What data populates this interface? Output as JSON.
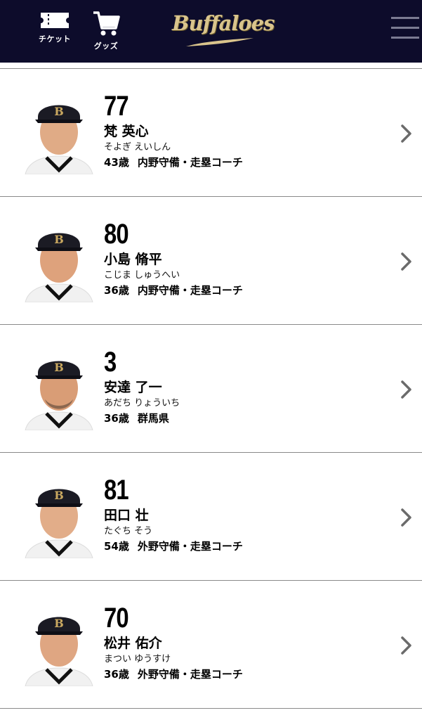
{
  "header": {
    "ticket_label": "チケット",
    "goods_label": "グッズ",
    "logo_text": "Buffaloes",
    "logo_icon": "buffaloes-logo",
    "menu_icon": "hamburger-menu-icon",
    "colors": {
      "header_bg": "#0d0c2b",
      "logo_gold": "#d9c48c",
      "menu_lines": "#7b7b92"
    }
  },
  "staff": [
    {
      "number": "77",
      "name": "梵 英心",
      "kana": "そよぎ えいしん",
      "age": "43歳",
      "role": "内野守備・走塁コーチ"
    },
    {
      "number": "80",
      "name": "小島 脩平",
      "kana": "こじま しゅうへい",
      "age": "36歳",
      "role": "内野守備・走塁コーチ"
    },
    {
      "number": "3",
      "name": "安達 了一",
      "kana": "あだち りょういち",
      "age": "36歳",
      "role": "群馬県"
    },
    {
      "number": "81",
      "name": "田口 壮",
      "kana": "たぐち そう",
      "age": "54歳",
      "role": "外野守備・走塁コーチ"
    },
    {
      "number": "70",
      "name": "松井 佑介",
      "kana": "まつい ゆうすけ",
      "age": "36歳",
      "role": "外野守備・走塁コーチ"
    }
  ]
}
